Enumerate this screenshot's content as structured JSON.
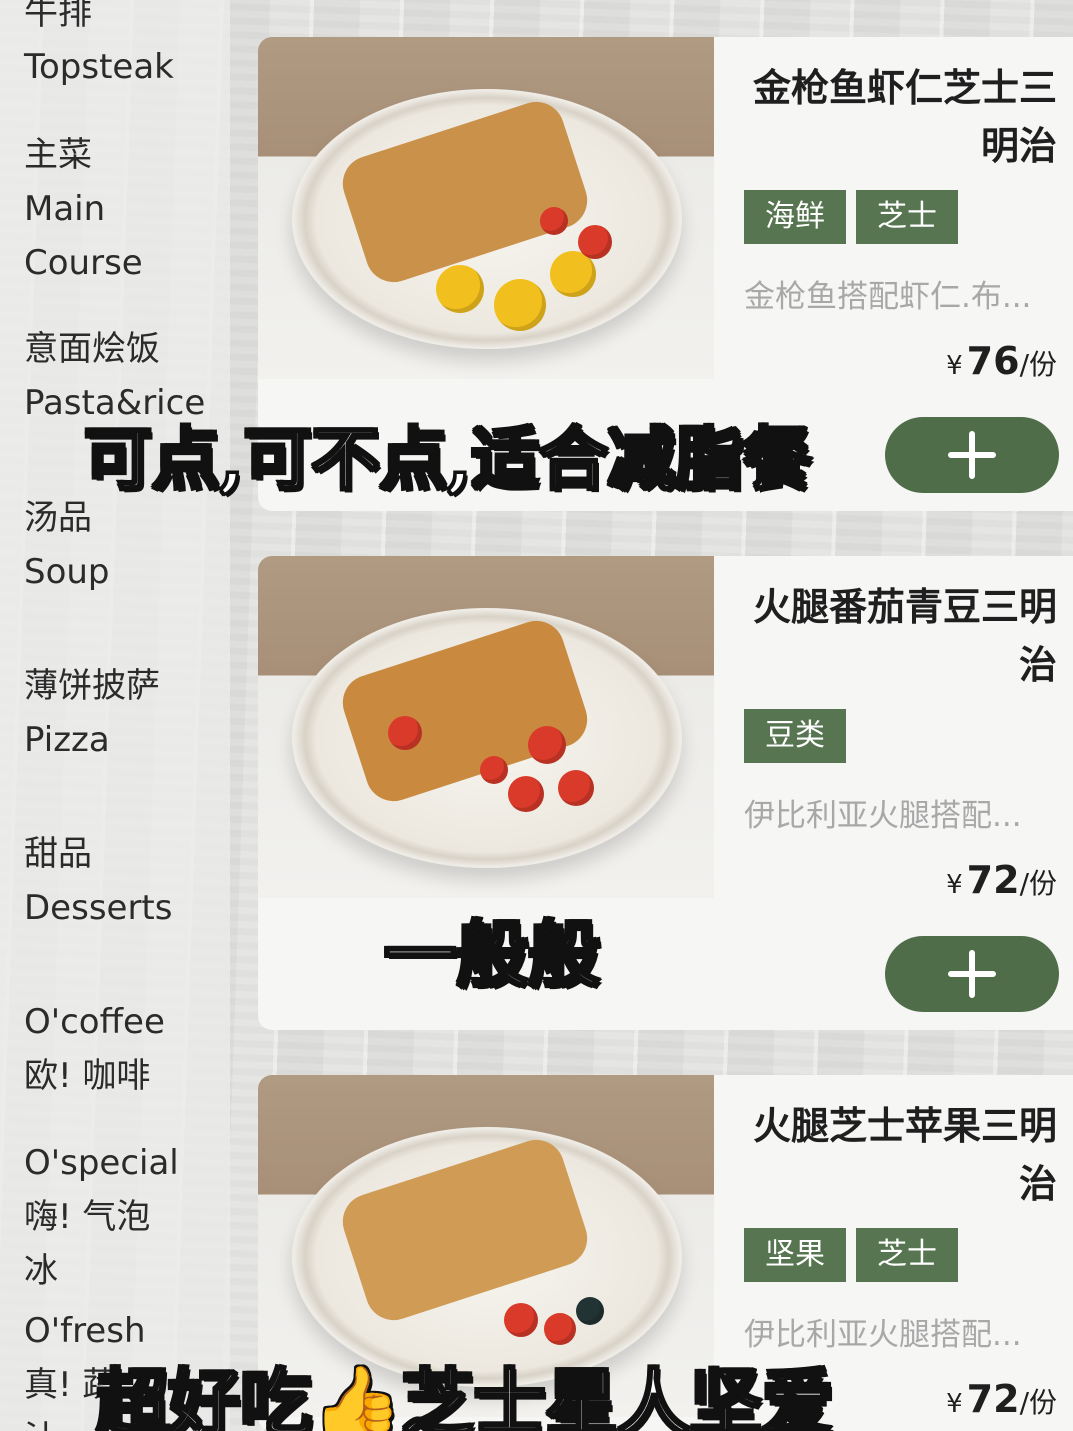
{
  "sidebar": {
    "items": [
      {
        "zh": "牛排",
        "en": "Topsteak"
      },
      {
        "zh": "主菜",
        "en": "Main",
        "en2": "Course"
      },
      {
        "zh": "意面烩饭",
        "en": "Pasta&rice"
      },
      {
        "zh": "汤品",
        "en": "Soup"
      },
      {
        "zh": "薄饼披萨",
        "en": "Pizza"
      },
      {
        "zh": "甜品",
        "en": "Desserts"
      },
      {
        "en": "O'coffee",
        "zh": "欧! 咖啡"
      },
      {
        "en": "O'special",
        "zh": "嗨! 气泡",
        "zh2": "冰"
      },
      {
        "en": "O'fresh",
        "zh": "真! 蔬",
        "zh2": "汁"
      }
    ]
  },
  "products": [
    {
      "title": "金枪鱼虾仁芝士三明治",
      "tags": [
        "海鲜",
        "芝士"
      ],
      "desc": "金枪鱼搭配虾仁.布...",
      "price_symbol": "¥",
      "price": "76",
      "unit": "/份"
    },
    {
      "title": "火腿番茄青豆三明治",
      "tags": [
        "豆类"
      ],
      "desc": "伊比利亚火腿搭配...",
      "price_symbol": "¥",
      "price": "72",
      "unit": "/份"
    },
    {
      "title": "火腿芝士苹果三明治",
      "tags": [
        "坚果",
        "芝士"
      ],
      "desc": "伊比利亚火腿搭配...",
      "price_symbol": "¥",
      "price": "72",
      "unit": "/份"
    }
  ],
  "captions": {
    "first": "可点,可不点,适合减脂餐",
    "second": "一般般",
    "third": "超好吃👍芝士星人坚爱"
  },
  "colors": {
    "accent": "#567550",
    "button": "#4f6d49"
  },
  "icons": {
    "add": "plus-icon"
  }
}
